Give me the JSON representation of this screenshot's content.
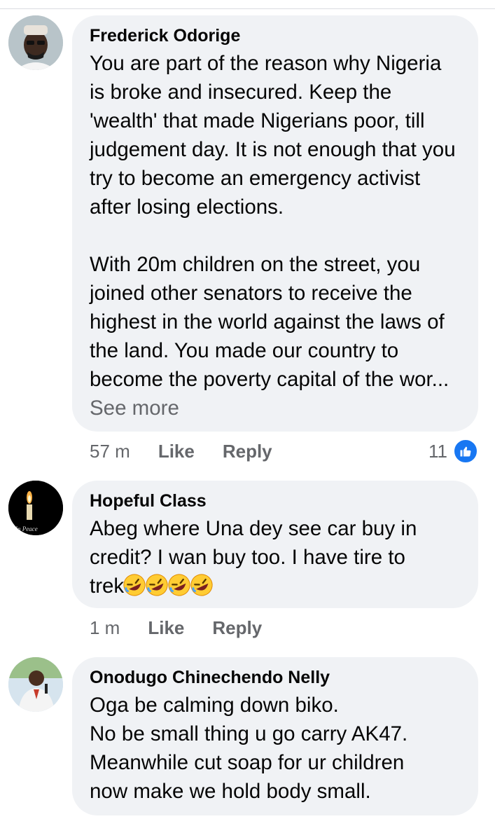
{
  "comments": [
    {
      "author": "Frederick Odorige",
      "text": "You are part of the reason why Nigeria is broke and insecured. Keep the 'wealth' that made Nigerians poor, till judgement day. It is not enough that you try to become an emergency activist after losing elections.\n\nWith 20m children on the street, you joined other senators to receive the highest in the world against the laws of the land. You made our country to become the poverty capital of the wor...",
      "see_more": "See more",
      "time": "57 m",
      "like_label": "Like",
      "reply_label": "Reply",
      "reaction_count": "11",
      "reaction_icon": "thumbs-up-icon"
    },
    {
      "author": "Hopeful Class",
      "text_lines": [
        "Abeg where Una dey see car buy in",
        "credit? I wan buy too. I have tire to"
      ],
      "text_last": "trek",
      "emojis": [
        "rolling-on-floor-laughing-emoji",
        "rolling-on-floor-laughing-emoji",
        "rolling-on-floor-laughing-emoji",
        "rolling-on-floor-laughing-emoji"
      ],
      "avatar_caption": "In Peace",
      "time": "1 m",
      "like_label": "Like",
      "reply_label": "Reply"
    },
    {
      "author": "Onodugo Chinechendo Nelly",
      "text": "Oga be calming down biko.\nNo be small thing u go carry AK47.\nMeanwhile cut soap for ur children\nnow make we hold body small."
    }
  ],
  "colors": {
    "bubble": "#f0f2f5",
    "secondary_text": "#65676b",
    "like_blue": "#1877f2"
  }
}
